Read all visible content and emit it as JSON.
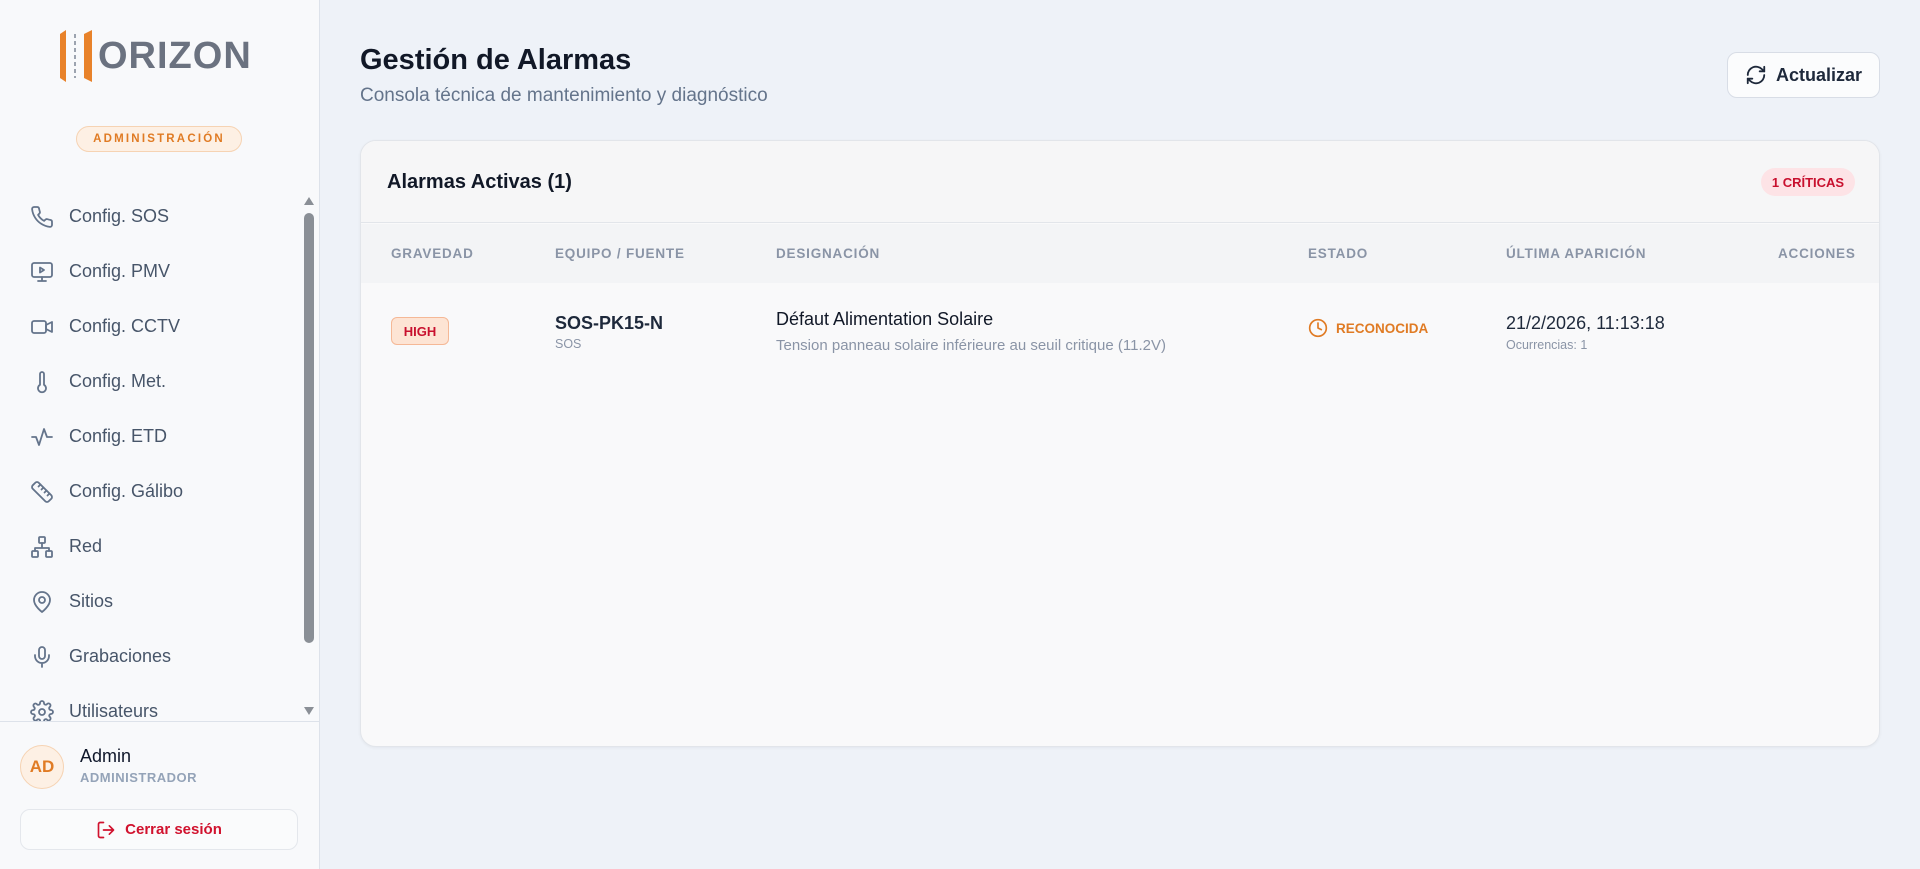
{
  "app": {
    "logo_text": "ORIZON",
    "role_badge": "ADMINISTRACIÓN"
  },
  "sidebar": {
    "items": [
      {
        "label": "Config. SOS",
        "icon": "phone-icon"
      },
      {
        "label": "Config. PMV",
        "icon": "monitor-play-icon"
      },
      {
        "label": "Config. CCTV",
        "icon": "video-camera-icon"
      },
      {
        "label": "Config. Met.",
        "icon": "thermometer-icon"
      },
      {
        "label": "Config. ETD",
        "icon": "activity-pulse-icon"
      },
      {
        "label": "Config. Gálibo",
        "icon": "ruler-icon"
      },
      {
        "label": "Red",
        "icon": "network-icon"
      },
      {
        "label": "Sitios",
        "icon": "map-pin-icon"
      },
      {
        "label": "Grabaciones",
        "icon": "microphone-icon"
      },
      {
        "label": "Utilisateurs",
        "icon": "gear-icon"
      }
    ]
  },
  "user": {
    "initials": "AD",
    "name": "Admin",
    "role": "ADMINISTRADOR",
    "logout_label": "Cerrar sesión"
  },
  "header": {
    "title": "Gestión de Alarmas",
    "subtitle": "Consola técnica de mantenimiento y diagnóstico",
    "refresh_label": "Actualizar"
  },
  "alarms": {
    "title": "Alarmas Activas (1)",
    "critical_badge": "1 CRÍTICAS",
    "columns": [
      "GRAVEDAD",
      "EQUIPO / FUENTE",
      "DESIGNACIÓN",
      "ESTADO",
      "ÚLTIMA APARICIÓN",
      "ACCIONES"
    ],
    "rows": [
      {
        "severity": "HIGH",
        "equipment": "SOS-PK15-N",
        "source_type": "SOS",
        "designation": "Défaut Alimentation Solaire",
        "description": "Tension panneau solaire inférieure au seuil critique (11.2V)",
        "state": "RECONOCIDA",
        "last_seen": "21/2/2026, 11:13:18",
        "occurrences": "Ocurrencias: 1"
      }
    ]
  },
  "colors": {
    "accent_orange": "#e07b24",
    "critical_red": "#c8102e",
    "text_dark": "#111827",
    "text_muted": "#8a94a6"
  }
}
